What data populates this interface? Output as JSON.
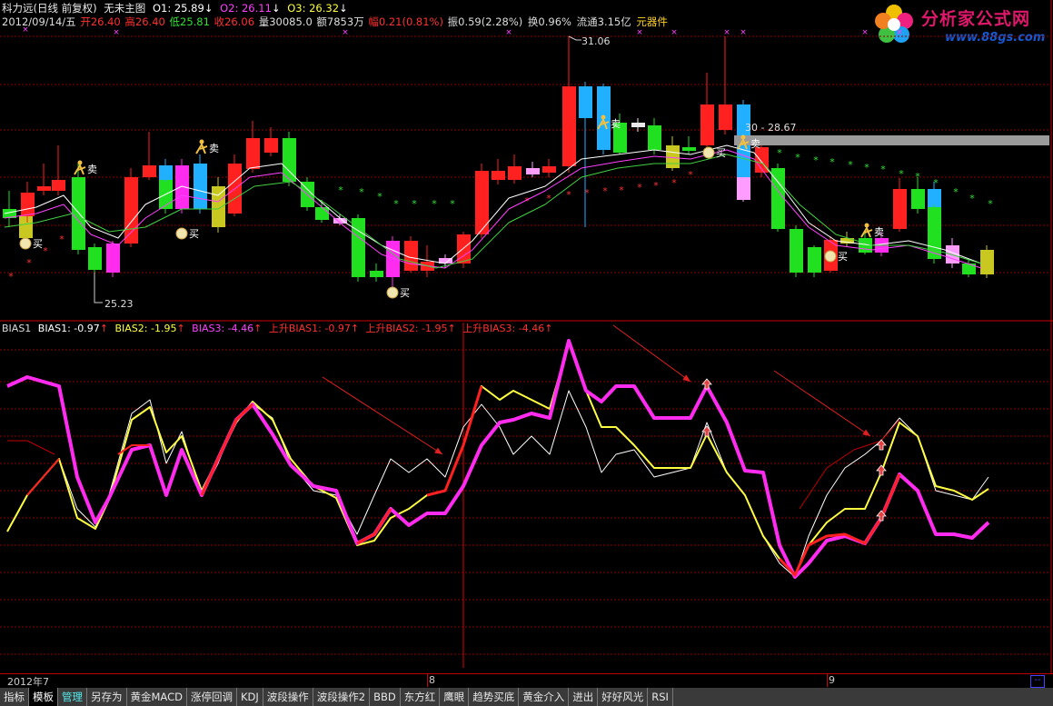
{
  "header": {
    "stock": "科力远(日线 前复权)",
    "main_chart": "无未主图",
    "o1_label": "O1: 25.89",
    "o1_arrow": "↓",
    "o2_label": "O2: 26.11",
    "o2_arrow": "↓",
    "o3_label": "O3: 26.32",
    "o3_arrow": "↓",
    "date": "2012/09/14/五",
    "open": "开26.40",
    "high": "高26.40",
    "low": "低25.81",
    "close": "收26.06",
    "volume": "量30085.0",
    "amount": "额7853万",
    "change": "幅0.21(0.81%)",
    "amplitude": "振0.59(2.28%)",
    "turnover": "换0.96%",
    "float_cap": "流通3.15亿",
    "sector": "元器件"
  },
  "logo": {
    "title": "分析家公式网",
    "url": "www.88gs.com"
  },
  "price_labels": {
    "high_mark": "31.06",
    "low_mark": "25.23",
    "range": "30 - 28.67"
  },
  "signals": {
    "buy": "买",
    "sell": "卖"
  },
  "indicator": {
    "name": "BIAS1",
    "b1": "BIAS1: -0.97",
    "b2": "BIAS2: -1.95",
    "b3": "BIAS3: -4.46",
    "u1": "上升BIAS1: -0.97",
    "u2": "上升BIAS2: -1.95",
    "u3": "上升BIAS3: -4.46",
    "arrow": "↑"
  },
  "dates": {
    "d1": "2012年7",
    "d2": "8",
    "d3": "9"
  },
  "tabs": [
    "指标",
    "模板",
    "管理",
    "另存为",
    "黄金MACD",
    "涨停回调",
    "KDJ",
    "波段操作",
    "波段操作2",
    "BBD",
    "东方红",
    "鹰眼",
    "趋势买底",
    "黄金介入",
    "进出",
    "好好风光",
    "RSI"
  ],
  "colors": {
    "up": "#ff2020",
    "down": "#20e020",
    "grid": "#8a0000",
    "magenta": "#ff2cf0",
    "yellow": "#ffff40"
  }
}
